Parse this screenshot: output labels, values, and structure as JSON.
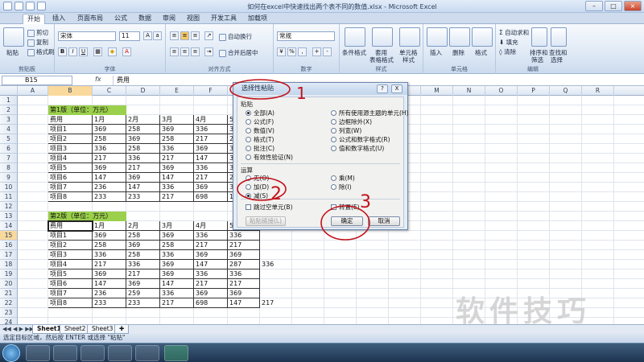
{
  "window": {
    "title": "如何在excel中快速找出两个表不同的数值.xlsx - Microsoft Excel"
  },
  "tabs": [
    "开始",
    "插入",
    "页面布局",
    "公式",
    "数据",
    "审阅",
    "视图",
    "开发工具",
    "加载项"
  ],
  "ribbon": {
    "paste": "粘贴",
    "cut": "剪切",
    "copy": "复制",
    "format_painter": "格式刷",
    "font_name": "宋体",
    "font_size": "11",
    "bold": "B",
    "italic": "I",
    "underline": "U",
    "wrap_text": "自动换行",
    "merge_center": "合并后居中",
    "number_format": "常规",
    "conditional_format": "条件格式",
    "table_format_1": "套用",
    "table_format_2": "表格格式",
    "cell_style_1": "单元格",
    "cell_style_2": "样式",
    "insert": "插入",
    "delete": "删除",
    "format": "格式",
    "autosum": "自动求和",
    "fill": "填充",
    "clear": "清除",
    "sort_filter_1": "排序和",
    "sort_filter_2": "筛选",
    "find_select_1": "查找和",
    "find_select_2": "选择",
    "groups": [
      "剪贴板",
      "字体",
      "对齐方式",
      "数字",
      "样式",
      "单元格",
      "编辑"
    ]
  },
  "formula_bar": {
    "name_box": "B15",
    "fx": "fx",
    "content": "费用"
  },
  "columns": [
    "A",
    "B",
    "C",
    "D",
    "E",
    "F",
    "G",
    "H",
    "I",
    "J",
    "K",
    "L",
    "M",
    "N",
    "O",
    "P",
    "Q",
    "R"
  ],
  "table1": {
    "title": "第1版（单位：万元）",
    "header": [
      "费用",
      "1月",
      "2月",
      "3月",
      "4月",
      "5月"
    ],
    "rows": [
      [
        "项目1",
        "369",
        "258",
        "369",
        "336",
        "336"
      ],
      [
        "项目2",
        "258",
        "369",
        "258",
        "217",
        "217"
      ],
      [
        "项目3",
        "336",
        "258",
        "336",
        "369",
        "369"
      ],
      [
        "项目4",
        "217",
        "336",
        "217",
        "147",
        "336"
      ],
      [
        "项目5",
        "369",
        "217",
        "369",
        "336",
        "336"
      ],
      [
        "项目6",
        "147",
        "369",
        "147",
        "217",
        "217"
      ],
      [
        "项目7",
        "236",
        "147",
        "336",
        "369",
        "369"
      ],
      [
        "项目8",
        "233",
        "233",
        "217",
        "698",
        "147"
      ]
    ]
  },
  "table2": {
    "title": "第2版（单位：万元）",
    "header": [
      "费用",
      "1月",
      "2月",
      "3月",
      "4月",
      "5月"
    ],
    "rows": [
      [
        "项目1",
        "369",
        "258",
        "369",
        "336",
        "336"
      ],
      [
        "项目2",
        "258",
        "369",
        "258",
        "217",
        "217"
      ],
      [
        "项目3",
        "336",
        "258",
        "336",
        "369",
        "369"
      ],
      [
        "项目4",
        "217",
        "336",
        "369",
        "147",
        "287",
        "336"
      ],
      [
        "项目5",
        "369",
        "217",
        "369",
        "336",
        "336"
      ],
      [
        "项目6",
        "147",
        "369",
        "147",
        "217",
        "217"
      ],
      [
        "项目7",
        "236",
        "259",
        "336",
        "369",
        "369"
      ],
      [
        "项目8",
        "233",
        "233",
        "217",
        "698",
        "147",
        "217"
      ]
    ]
  },
  "sheets": [
    "Sheet1",
    "Sheet2",
    "Sheet3"
  ],
  "status": "选定目标区域，然后按 ENTER 或选择 \"粘贴\"",
  "dialog": {
    "title": "选择性粘贴",
    "help": "?",
    "close": "X",
    "paste_section": "粘贴",
    "paste_options": [
      "全部(A)",
      "公式(F)",
      "数值(V)",
      "格式(T)",
      "批注(C)",
      "有效性验证(N)"
    ],
    "paste_options_right": [
      "所有使用源主题的单元(H)",
      "边框除外(X)",
      "列宽(W)",
      "公式和数字格式(R)",
      "值和数字格式(U)"
    ],
    "operation_section": "运算",
    "op_left": [
      "无(O)",
      "加(D)",
      "减(S)"
    ],
    "op_right": [
      "乘(M)",
      "除(I)"
    ],
    "skip_blanks": "跳过空单元(B)",
    "transpose": "转置(E)",
    "paste_link": "粘贴链接(L)",
    "ok": "确定",
    "cancel": "取消"
  },
  "annotations": [
    "1",
    "2",
    "3"
  ],
  "watermark": "软件技巧"
}
